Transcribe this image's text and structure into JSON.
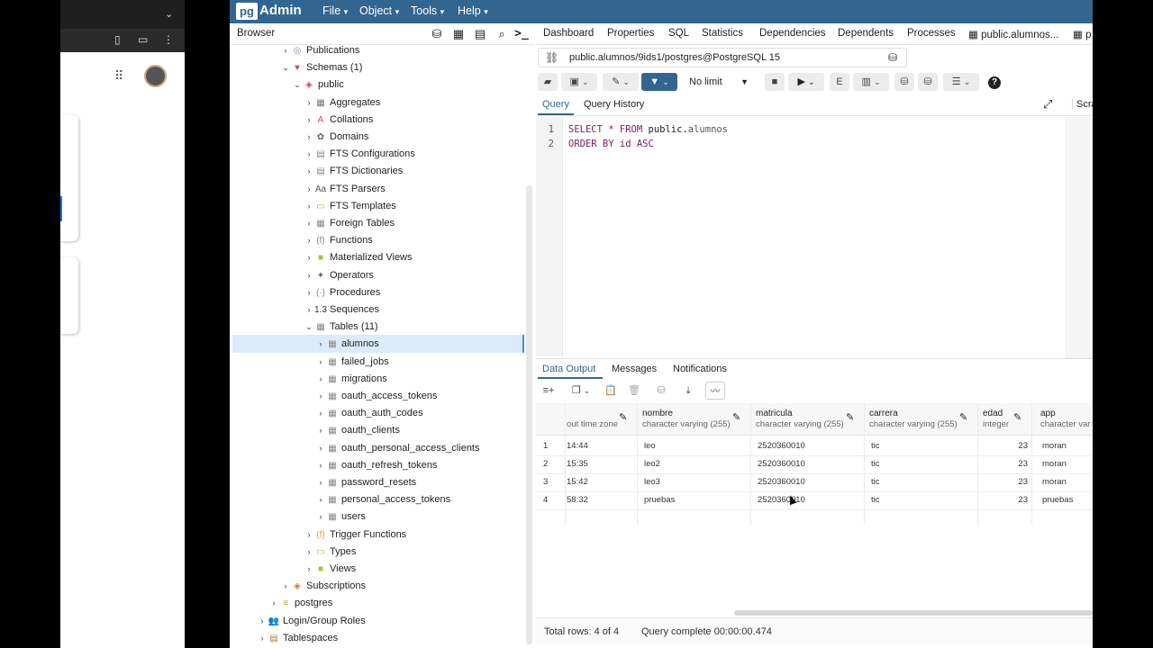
{
  "app": {
    "logo_prefix": "pg",
    "logo_name": "Admin"
  },
  "menu": [
    "File",
    "Object",
    "Tools",
    "Help"
  ],
  "browser": {
    "title": "Browser",
    "tree": [
      {
        "label": "Publications",
        "level": 4,
        "chev": "›",
        "icon": "publications-icon",
        "sym": "◎",
        "color": "#9a7fb5"
      },
      {
        "label": "Schemas (1)",
        "level": 4,
        "chev": "⌄",
        "icon": "schemas-icon",
        "sym": "♥",
        "color": "#c94a6b"
      },
      {
        "label": "public",
        "level": 5,
        "chev": "⌄",
        "icon": "schema-icon",
        "sym": "◈",
        "color": "#c94a6b"
      },
      {
        "label": "Aggregates",
        "level": 6,
        "chev": "›",
        "icon": "aggregates-icon",
        "sym": "▦",
        "color": "#777"
      },
      {
        "label": "Collations",
        "level": 6,
        "chev": "›",
        "icon": "collations-icon",
        "sym": "A",
        "color": "#c94a6b"
      },
      {
        "label": "Domains",
        "level": 6,
        "chev": "›",
        "icon": "domains-icon",
        "sym": "✿",
        "color": "#666"
      },
      {
        "label": "FTS Configurations",
        "level": 6,
        "chev": "›",
        "icon": "fts-configurations-icon",
        "sym": "▤",
        "color": "#888"
      },
      {
        "label": "FTS Dictionaries",
        "level": 6,
        "chev": "›",
        "icon": "fts-dictionaries-icon",
        "sym": "▤",
        "color": "#888"
      },
      {
        "label": "FTS Parsers",
        "level": 6,
        "chev": "›",
        "icon": "fts-parsers-icon",
        "sym": "Aa",
        "color": "#555"
      },
      {
        "label": "FTS Templates",
        "level": 6,
        "chev": "›",
        "icon": "fts-templates-icon",
        "sym": "▭",
        "color": "#d5a43a"
      },
      {
        "label": "Foreign Tables",
        "level": 6,
        "chev": "›",
        "icon": "foreign-tables-icon",
        "sym": "▦",
        "color": "#888"
      },
      {
        "label": "Functions",
        "level": 6,
        "chev": "›",
        "icon": "functions-icon",
        "sym": "(f)",
        "color": "#888"
      },
      {
        "label": "Materialized Views",
        "level": 6,
        "chev": "›",
        "icon": "materialized-views-icon",
        "sym": "■",
        "color": "#9bc93a"
      },
      {
        "label": "Operators",
        "level": 6,
        "chev": "›",
        "icon": "operators-icon",
        "sym": "✦",
        "color": "#666"
      },
      {
        "label": "Procedures",
        "level": 6,
        "chev": "›",
        "icon": "procedures-icon",
        "sym": "(·)",
        "color": "#888"
      },
      {
        "label": "Sequences",
        "level": 6,
        "chev": "›",
        "icon": "sequences-icon",
        "sym": "1.3",
        "color": "#333"
      },
      {
        "label": "Tables (11)",
        "level": 6,
        "chev": "⌄",
        "icon": "tables-icon",
        "sym": "▦",
        "color": "#888"
      },
      {
        "label": "alumnos",
        "level": 7,
        "chev": "›",
        "icon": "table-icon",
        "sym": "▦",
        "color": "#888"
      },
      {
        "label": "failed_jobs",
        "level": 7,
        "chev": "›",
        "icon": "table-icon",
        "sym": "▦",
        "color": "#888"
      },
      {
        "label": "migrations",
        "level": 7,
        "chev": "›",
        "icon": "table-icon",
        "sym": "▦",
        "color": "#888"
      },
      {
        "label": "oauth_access_tokens",
        "level": 7,
        "chev": "›",
        "icon": "table-icon",
        "sym": "▦",
        "color": "#888"
      },
      {
        "label": "oauth_auth_codes",
        "level": 7,
        "chev": "›",
        "icon": "table-icon",
        "sym": "▦",
        "color": "#888"
      },
      {
        "label": "oauth_clients",
        "level": 7,
        "chev": "›",
        "icon": "table-icon",
        "sym": "▦",
        "color": "#888"
      },
      {
        "label": "oauth_personal_access_clients",
        "level": 7,
        "chev": "›",
        "icon": "table-icon",
        "sym": "▦",
        "color": "#888"
      },
      {
        "label": "oauth_refresh_tokens",
        "level": 7,
        "chev": "›",
        "icon": "table-icon",
        "sym": "▦",
        "color": "#888"
      },
      {
        "label": "password_resets",
        "level": 7,
        "chev": "›",
        "icon": "table-icon",
        "sym": "▦",
        "color": "#888"
      },
      {
        "label": "personal_access_tokens",
        "level": 7,
        "chev": "›",
        "icon": "table-icon",
        "sym": "▦",
        "color": "#888"
      },
      {
        "label": "users",
        "level": 7,
        "chev": "›",
        "icon": "table-icon",
        "sym": "▦",
        "color": "#888"
      },
      {
        "label": "Trigger Functions",
        "level": 6,
        "chev": "›",
        "icon": "trigger-functions-icon",
        "sym": "(f)",
        "color": "#d5a43a"
      },
      {
        "label": "Types",
        "level": 6,
        "chev": "›",
        "icon": "types-icon",
        "sym": "▭",
        "color": "#9bc93a"
      },
      {
        "label": "Views",
        "level": 6,
        "chev": "›",
        "icon": "views-icon",
        "sym": "■",
        "color": "#9bc93a"
      },
      {
        "label": "Subscriptions",
        "level": 4,
        "chev": "›",
        "icon": "subscriptions-icon",
        "sym": "◈",
        "color": "#c97a3a"
      },
      {
        "label": "postgres",
        "level": 3,
        "chev": "›",
        "icon": "database-icon",
        "sym": "≡",
        "color": "#b7a43a"
      },
      {
        "label": "Login/Group Roles",
        "level": 2,
        "chev": "›",
        "icon": "roles-icon",
        "sym": "👥",
        "color": "#555"
      },
      {
        "label": "Tablespaces",
        "level": 2,
        "chev": "›",
        "icon": "tablespaces-icon",
        "sym": "▤",
        "color": "#c97a3a"
      }
    ]
  },
  "tabs": [
    "Dashboard",
    "Properties",
    "SQL",
    "Statistics",
    "Dependencies",
    "Dependents",
    "Processes",
    "public.alumnos...",
    "p"
  ],
  "connection": "public.alumnos/9ids1/postgres@PostgreSQL 15",
  "limit": "No limit",
  "query_tabs": [
    "Query",
    "Query History"
  ],
  "scratch_tab": "Scra",
  "editor": {
    "line1_kw1": "SELECT * FROM",
    "line1_schema": "public.",
    "line1_table": "alumnos",
    "line2": "ORDER BY id ASC"
  },
  "output_tabs": [
    "Data Output",
    "Messages",
    "Notifications"
  ],
  "grid": {
    "columns": [
      {
        "name": "",
        "type": "out time zone"
      },
      {
        "name": "nombre",
        "type": "character varying (255)"
      },
      {
        "name": "matricula",
        "type": "character varying (255)"
      },
      {
        "name": "carrera",
        "type": "character varying (255)"
      },
      {
        "name": "edad",
        "type": "integer"
      },
      {
        "name": "app",
        "type": "character var"
      }
    ],
    "rows": [
      [
        "1",
        "14:44",
        "leo",
        "2520360010",
        "tic",
        "23",
        "moran"
      ],
      [
        "2",
        "15:35",
        "leo2",
        "2520360010",
        "tic",
        "23",
        "moran"
      ],
      [
        "3",
        "15:42",
        "leo3",
        "2520360010",
        "tic",
        "23",
        "moran"
      ],
      [
        "4",
        "58:32",
        "pruebas",
        "2520360010",
        "tic",
        "23",
        "pruebas"
      ]
    ]
  },
  "status": {
    "total_rows": "Total rows: 4 of 4",
    "query_complete": "Query complete 00:00:00.474"
  }
}
